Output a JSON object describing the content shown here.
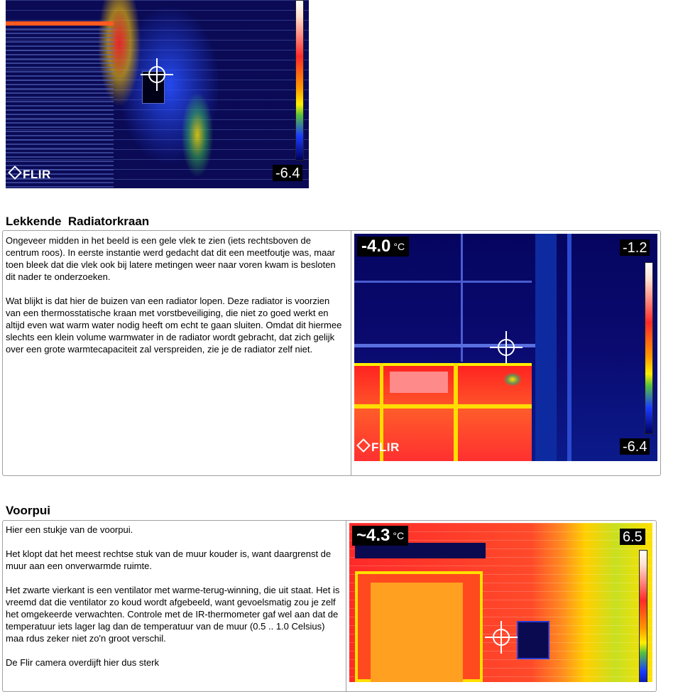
{
  "top_image": {
    "min_label": "-6.4",
    "logo": "FLIR"
  },
  "section1": {
    "title": "Lekkende  Radiatorkraan",
    "paragraphs": [
      "Ongeveer midden in het beeld is een gele vlek te zien (iets rechtsboven de centrum roos). In eerste instantie werd gedacht dat dit een meetfoutje was, maar toen bleek dat die vlek ook bij latere metingen weer naar voren kwam is besloten dit nader te onderzoeken.",
      "Wat blijkt is dat hier de buizen van een radiator lopen. Deze radiator is voorzien van een thermosstatische kraan met vorstbeveiliging, die niet zo goed werkt en altijd even wat warm water nodig heeft om echt te gaan sluiten. Omdat dit hiermee slechts een klein volume warmwater in de radiator wordt gebracht, dat zich gelijk over een grote warmtecapaciteit zal verspreiden, zie je de radiator zelf niet."
    ],
    "image": {
      "readout": "-4.0",
      "unit": "°C",
      "max_label": "-1.2",
      "min_label": "-6.4",
      "logo": "FLIR"
    }
  },
  "section2": {
    "title": "Voorpui",
    "paragraphs": [
      "Hier een stukje van de voorpui.",
      "Het klopt dat het meest rechtse stuk van de muur kouder is, want daargrenst de muur aan een onverwarmde ruimte.",
      "Het zwarte vierkant is een ventilator met warme-terug-winning, die uit staat. Het is vreemd dat die ventilator zo koud wordt afgebeeld, want gevoelsmatig zou je zelf het omgekeerde verwachten. Controle met de IR-thermometer gaf wel aan dat de temperatuur iets lager lag dan de temperatuur van de muur (0.5 .. 1.0 Celsius) maa rdus zeker niet zo'n groot verschil.",
      "De Flir camera overdijft hier dus sterk"
    ],
    "image": {
      "readout": "~4.3",
      "unit": "°C",
      "max_label": "6.5"
    }
  }
}
